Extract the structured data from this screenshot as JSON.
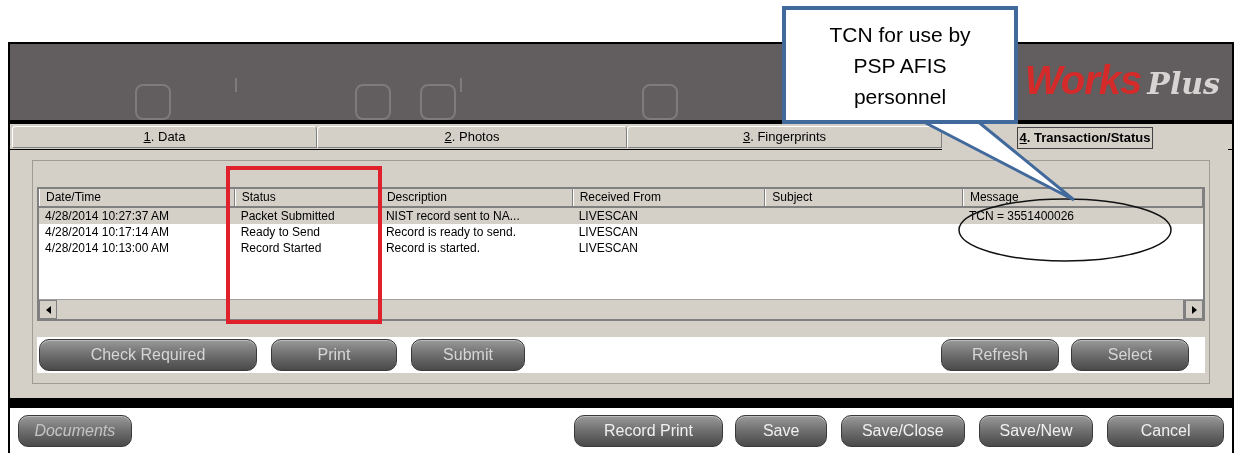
{
  "header": {
    "logo": {
      "brand": "Works",
      "suffix": "Plus"
    }
  },
  "tabs": [
    {
      "mnemonic": "1",
      "label": ". Data",
      "selected": false
    },
    {
      "mnemonic": "2",
      "label": ". Photos",
      "selected": false
    },
    {
      "mnemonic": "3",
      "label": ". Fingerprints",
      "selected": false
    },
    {
      "mnemonic": "4",
      "label": ". Transaction/Status",
      "selected": true
    }
  ],
  "table": {
    "columns": [
      "Date/Time",
      "Status",
      "Description",
      "Received From",
      "Subject",
      "Message"
    ],
    "rows": [
      {
        "date_time": "4/28/2014 10:27:37 AM",
        "status": "Packet Submitted",
        "description": "NIST record sent to NA...",
        "received_from": "LIVESCAN",
        "message": "TCN = 3551400026",
        "selected": true
      },
      {
        "date_time": "4/28/2014 10:17:14 AM",
        "status": "Ready to Send",
        "description": "Record is ready to send.",
        "received_from": "LIVESCAN",
        "selected": false
      },
      {
        "date_time": "4/28/2014 10:13:00 AM",
        "status": "Record Started",
        "description": "Record is started.",
        "received_from": "LIVESCAN",
        "selected": false
      }
    ]
  },
  "left_buttons": [
    "Check Required",
    "Print",
    "Submit"
  ],
  "right_buttons": [
    "Refresh",
    "Select"
  ],
  "footer_buttons": [
    {
      "label": "Documents",
      "disabled": true
    },
    {
      "label": "Record Print",
      "disabled": false
    },
    {
      "label": "Save",
      "disabled": false
    },
    {
      "label": "Save/Close",
      "disabled": false
    },
    {
      "label": "Save/New",
      "disabled": false
    },
    {
      "label": "Cancel",
      "disabled": false
    }
  ],
  "callout": {
    "lines": [
      "TCN for use by",
      "PSP AFIS",
      "personnel"
    ]
  }
}
